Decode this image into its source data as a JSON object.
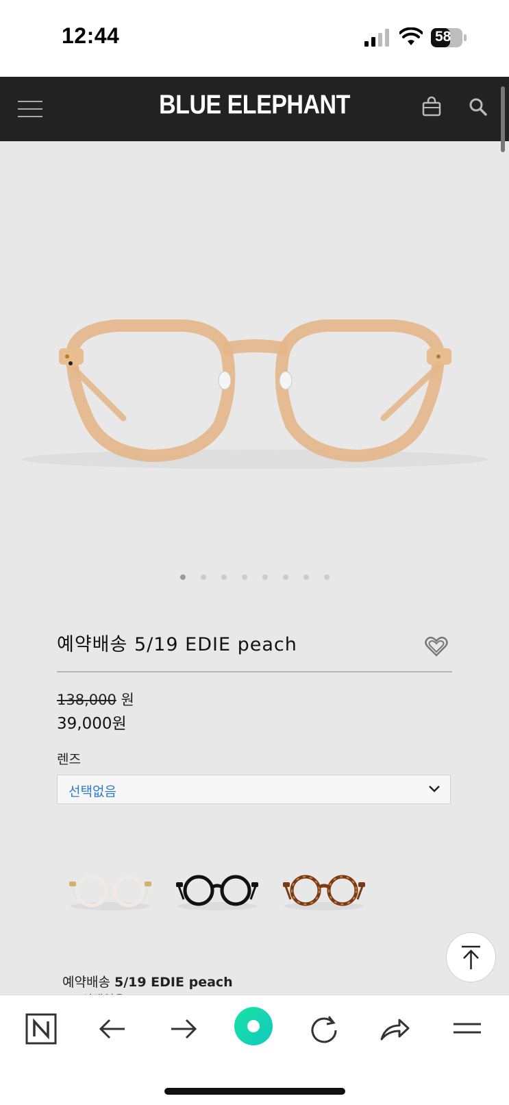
{
  "status_bar": {
    "time": "12:44",
    "battery": "58"
  },
  "header": {
    "brand": "BLUE ELEPHANT"
  },
  "carousel": {
    "total": 8,
    "active_index": 0
  },
  "product": {
    "title": "예약배송 5/19 EDIE peach",
    "original_price": "138,000",
    "original_price_unit": "원",
    "sale_price": "39,000원"
  },
  "lens": {
    "label": "렌즈",
    "selected": "선택없음"
  },
  "variants": [
    {
      "name": "clear",
      "frame_color": "#e6e2dc"
    },
    {
      "name": "black",
      "frame_color": "#111111"
    },
    {
      "name": "tortoise",
      "frame_color": "#7a3a15"
    }
  ],
  "selected_summary": {
    "prefix": "예약배송",
    "name": "5/19 EDIE peach",
    "option": "- 선택없음"
  },
  "icons": [
    "menu-icon",
    "bag-icon",
    "search-icon",
    "heart-icon",
    "chevron-down-icon",
    "arrow-up-icon",
    "naver-icon",
    "back-arrow-icon",
    "forward-arrow-icon",
    "green-dot-icon",
    "reload-icon",
    "share-icon",
    "menu-lines-icon"
  ],
  "colors": {
    "header_bg": "#222222",
    "accent_blue": "#2a7bd6",
    "naver_green": "#1ed99a",
    "frame_peach": "#e4b68a"
  }
}
